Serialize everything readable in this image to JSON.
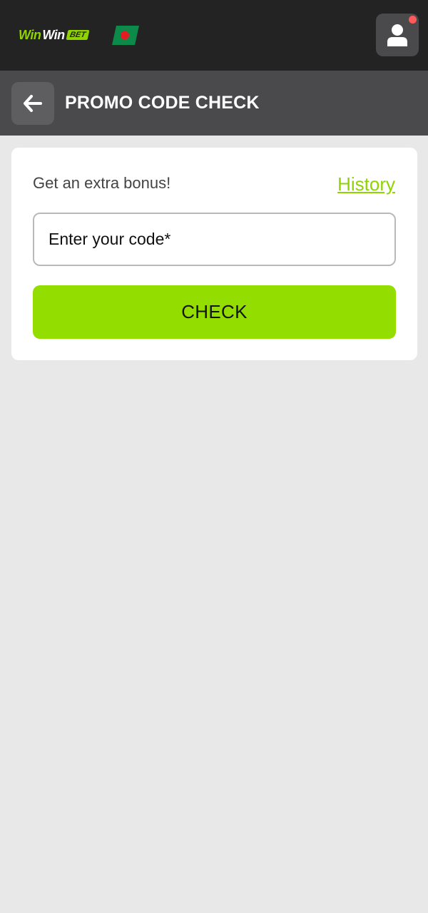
{
  "brand": {
    "logo_part1": "Win",
    "logo_part2": "Win",
    "logo_badge": "BET",
    "accent_color": "#93de00",
    "country_flag": "bangladesh-flag-icon"
  },
  "header": {
    "profile_icon": "user-icon",
    "has_notification": true
  },
  "subheader": {
    "back_icon": "arrow-left-icon",
    "title": "PROMO CODE CHECK"
  },
  "promo": {
    "tagline": "Get an extra bonus!",
    "history_link": "History",
    "input_value": "",
    "input_placeholder": "Enter your code*",
    "check_button": "CHECK"
  }
}
